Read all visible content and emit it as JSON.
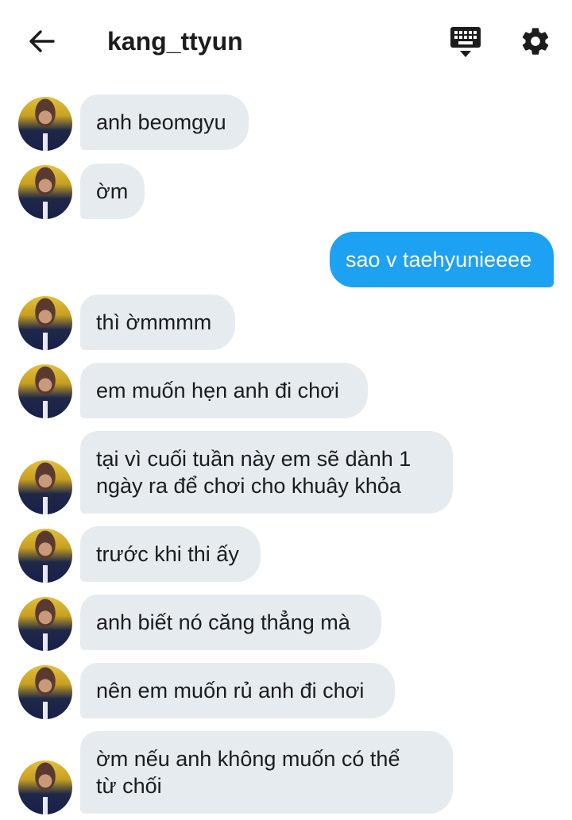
{
  "header": {
    "title": "kang_ttyun",
    "back_icon": "arrow-left-icon",
    "keyboard_icon": "keyboard-icon",
    "settings_icon": "gear-icon"
  },
  "colors": {
    "incoming_bubble": "#e6ebf0",
    "outgoing_bubble": "#1da1f2"
  },
  "messages": [
    {
      "side": "left",
      "text": "anh beomgyu"
    },
    {
      "side": "left",
      "text": "ờm"
    },
    {
      "side": "right",
      "text": "sao v taehyunieeee"
    },
    {
      "side": "left",
      "text": "thì ờmmmm"
    },
    {
      "side": "left",
      "text": "em muốn hẹn anh đi chơi"
    },
    {
      "side": "left",
      "text": "tại vì cuối tuần này em sẽ dành 1\nngày ra để chơi cho khuây khỏa"
    },
    {
      "side": "left",
      "text": "trước khi thi ấy"
    },
    {
      "side": "left",
      "text": "anh biết nó căng thẳng mà"
    },
    {
      "side": "left",
      "text": "nên em muốn rủ anh đi chơi"
    },
    {
      "side": "left",
      "text": "ờm nếu anh không muốn có thể\ntừ chối"
    }
  ]
}
